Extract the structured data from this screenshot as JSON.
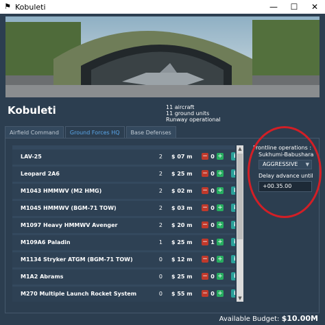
{
  "window": {
    "title": "Kobuleti",
    "icon": "flag-icon"
  },
  "airfield": {
    "name": "Kobuleti",
    "aircraft": "11 aircraft",
    "ground_units": "11 ground units",
    "status": "Runway operational"
  },
  "tabs": [
    {
      "label": "Airfield Command",
      "active": false
    },
    {
      "label": "Ground Forces HQ",
      "active": true
    },
    {
      "label": "Base Defenses",
      "active": false
    }
  ],
  "units": [
    {
      "name": "LAV-25",
      "count": "2",
      "price": "$ 07 m",
      "qty": "0"
    },
    {
      "name": "Leopard 2A6",
      "count": "2",
      "price": "$ 25 m",
      "qty": "0"
    },
    {
      "name": "M1043 HMMWV (M2 HMG)",
      "count": "2",
      "price": "$ 02 m",
      "qty": "0"
    },
    {
      "name": "M1045 HMMWV (BGM-71 TOW)",
      "count": "2",
      "price": "$ 03 m",
      "qty": "0"
    },
    {
      "name": "M1097 Heavy HMMWV Avenger",
      "count": "2",
      "price": "$ 20 m",
      "qty": "0"
    },
    {
      "name": "M109A6 Paladin",
      "count": "1",
      "price": "$ 25 m",
      "qty": "1"
    },
    {
      "name": "M1134 Stryker ATGM (BGM-71 TOW)",
      "count": "0",
      "price": "$ 12 m",
      "qty": "0"
    },
    {
      "name": "M1A2 Abrams",
      "count": "0",
      "price": "$ 25 m",
      "qty": "0"
    },
    {
      "name": "M270 Multiple Launch Rocket System",
      "count": "0",
      "price": "$ 55 m",
      "qty": "0"
    }
  ],
  "frontline": {
    "label": "Frontline operations :",
    "place": "Sukhumi-Babushara",
    "mode": "AGGRESSIVE",
    "delay_label": "Delay advance until",
    "delay_value": "+00.35.00"
  },
  "budget": {
    "label": "Available Budget:",
    "value": "$10.00M"
  },
  "colors": {
    "background": "#2c3e50",
    "active_tab": "#5aa7ea",
    "minus": "#c0392b",
    "plus": "#27ae60",
    "info": "#2aa19a",
    "annotation": "#d21f26"
  }
}
